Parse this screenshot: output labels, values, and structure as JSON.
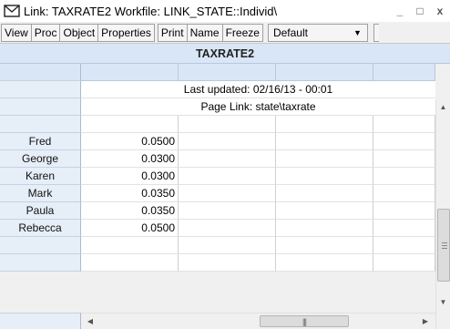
{
  "window": {
    "title": "Link: TAXRATE2   Workfile: LINK_STATE::Individ\\",
    "minimize_glyph": "_",
    "maximize_glyph": "□",
    "close_glyph": "x"
  },
  "toolbar": {
    "view_label": "View",
    "proc_label": "Proc",
    "object_label": "Object",
    "properties_label": "Properties",
    "print_label": "Print",
    "name_label": "Name",
    "freeze_label": "Freeze",
    "display_select_value": "Default"
  },
  "sheet": {
    "title": "TAXRATE2",
    "last_updated": "Last updated: 02/16/13 - 00:01",
    "page_link": "Page Link: state\\taxrate",
    "rows": [
      {
        "label": "Fred",
        "value": "0.0500"
      },
      {
        "label": "George",
        "value": "0.0300"
      },
      {
        "label": "Karen",
        "value": "0.0300"
      },
      {
        "label": "Mark",
        "value": "0.0350"
      },
      {
        "label": "Paula",
        "value": "0.0350"
      },
      {
        "label": "Rebecca",
        "value": "0.0500"
      }
    ]
  },
  "colors": {
    "header_band": "#d9e6f5",
    "row_header": "#e6eef8",
    "grid_line": "#d0d0d0"
  },
  "icons": {
    "app": "envelope-icon",
    "scroll_up": "up-arrow-icon",
    "scroll_down": "down-arrow-icon",
    "scroll_left": "left-arrow-icon",
    "scroll_right": "right-arrow-icon"
  }
}
